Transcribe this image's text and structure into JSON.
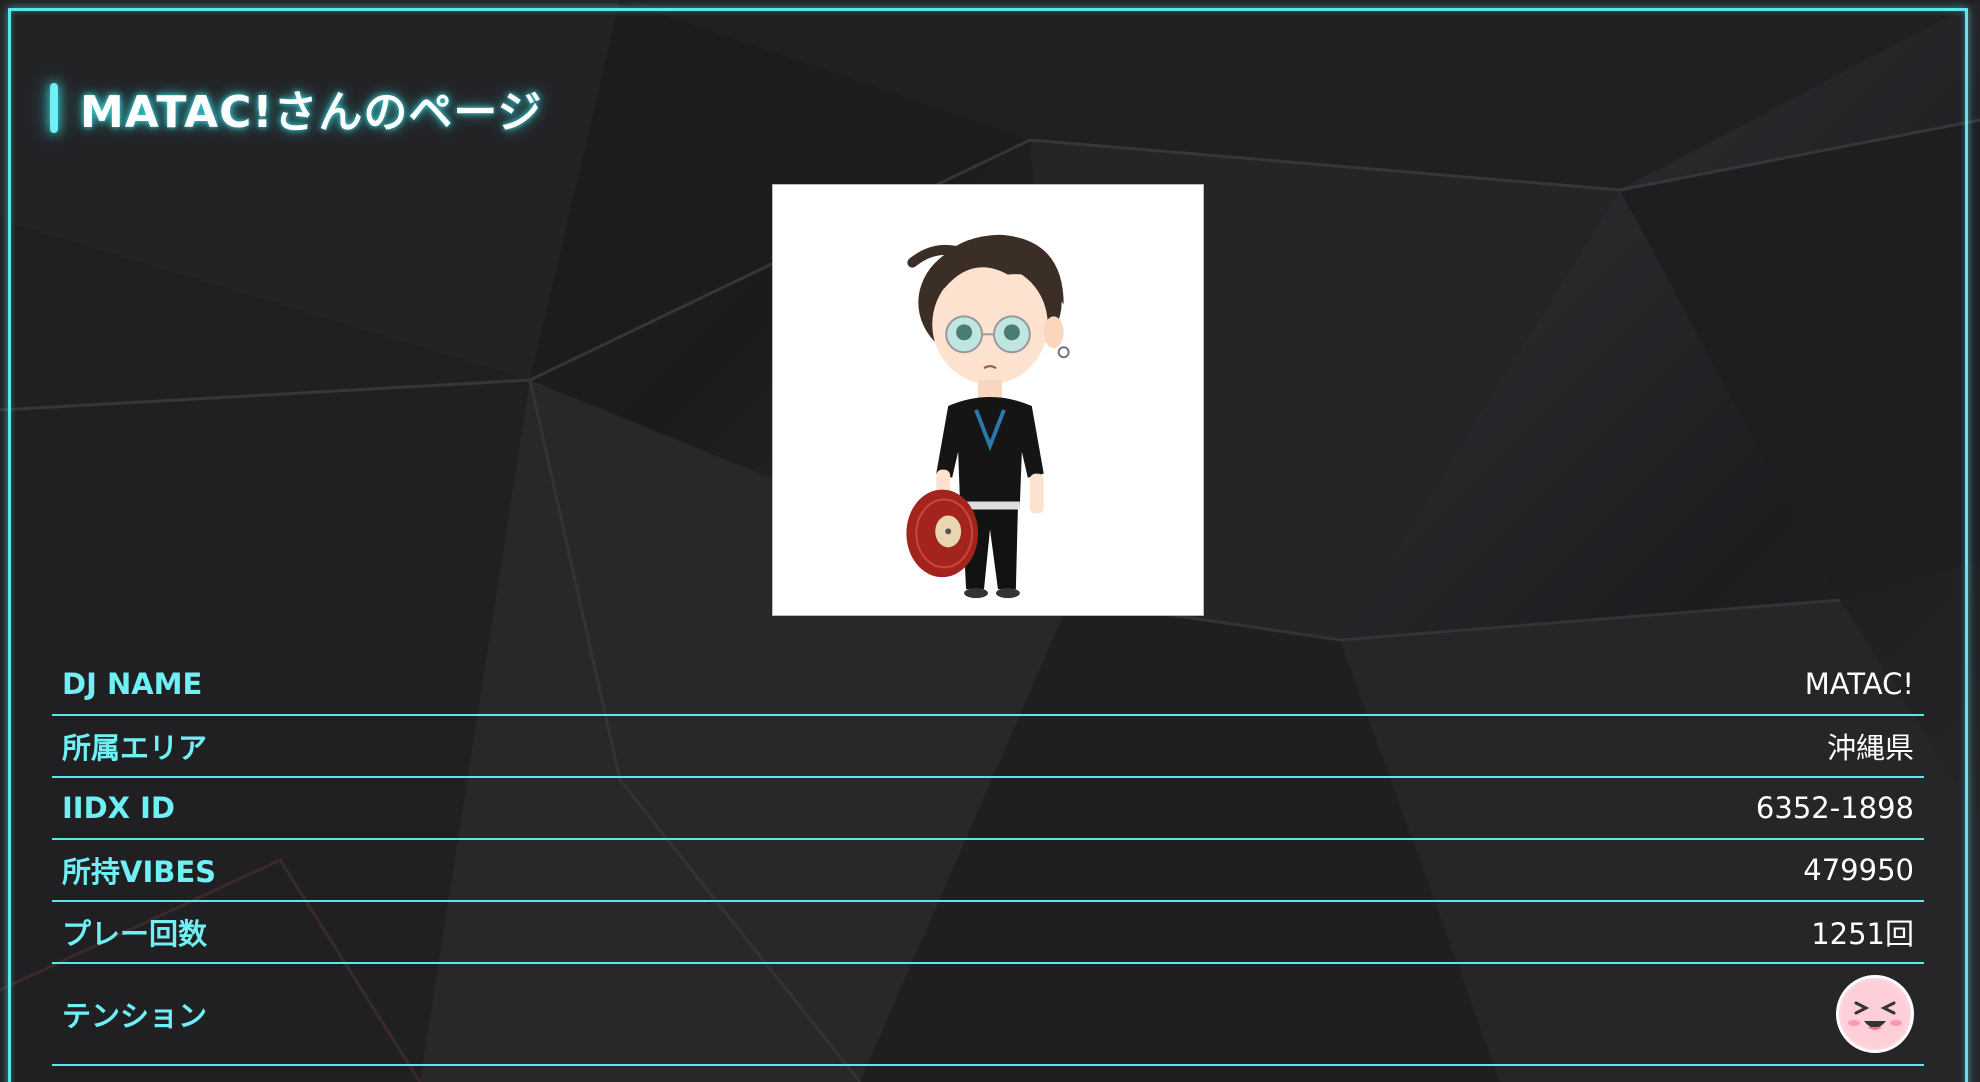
{
  "page": {
    "title": "MATAC!さんのページ"
  },
  "avatar": {
    "icon": "dj-avatar-icon"
  },
  "profile": {
    "rows": [
      {
        "label": "DJ NAME",
        "value": "MATAC!"
      },
      {
        "label": "所属エリア",
        "value": "沖縄県"
      },
      {
        "label": "IIDX ID",
        "value": "6352-1898"
      },
      {
        "label": "所持VIBES",
        "value": "479950"
      },
      {
        "label": "プレー回数",
        "value": "1251回"
      },
      {
        "label": "テンション",
        "icon": "tension-face-icon"
      }
    ]
  },
  "colors": {
    "accent": "#5fe6ec",
    "label": "#6ff0f5",
    "value": "#ffffff",
    "background": "#1f1f22"
  }
}
